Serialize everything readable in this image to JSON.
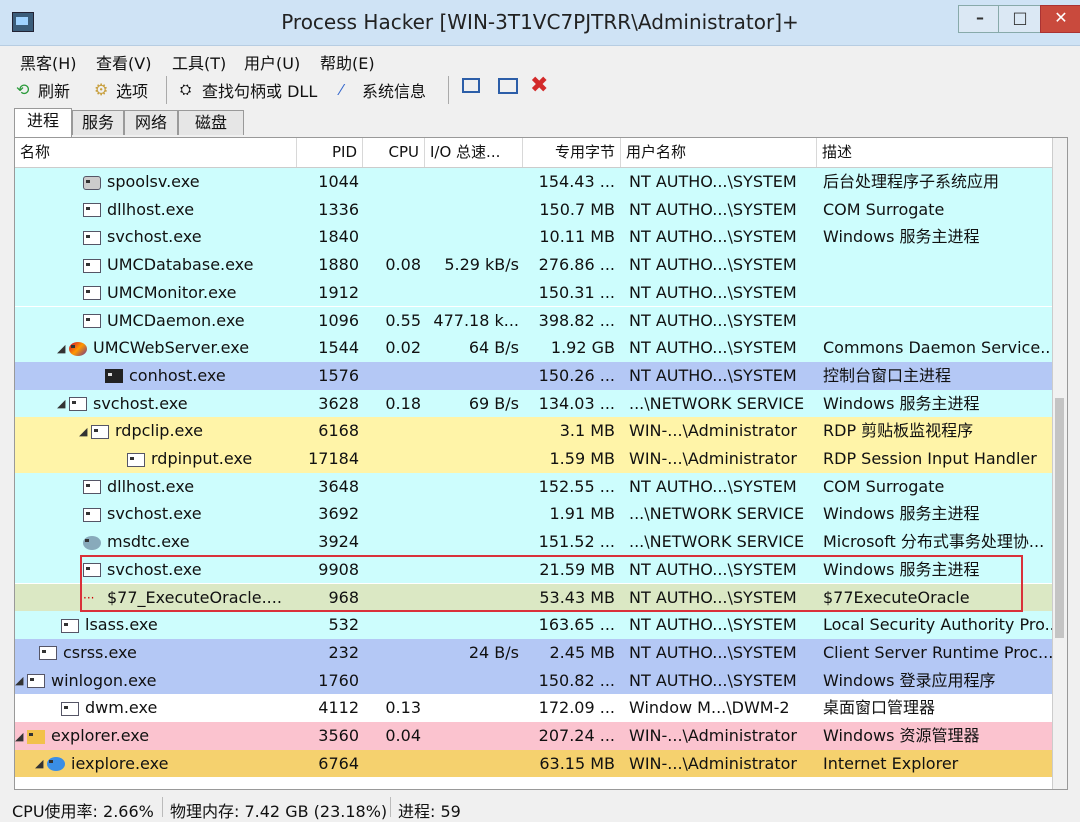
{
  "window": {
    "title": "Process Hacker [WIN-3T1VC7PJTRR\\Administrator]+"
  },
  "menu": [
    "黑客(H)",
    "查看(V)",
    "工具(T)",
    "用户(U)",
    "帮助(E)"
  ],
  "toolbar": {
    "refresh": "刷新",
    "options": "选项",
    "find": "查找句柄或 DLL",
    "sysinfo": "系统信息"
  },
  "tabs": [
    "进程",
    "服务",
    "网络",
    "磁盘"
  ],
  "columns": {
    "name": "名称",
    "pid": "PID",
    "cpu": "CPU",
    "io": "I/O 总速...",
    "mem": "专用字节",
    "user": "用户名称",
    "desc": "描述"
  },
  "colors": {
    "service": "#cdfdfd",
    "own": "#fff4a8",
    "system": "#b4c8f5",
    "pink": "#fbc3cf",
    "selected": "#dbe8c4",
    "white": "#ffffff",
    "orange": "#f5d16e"
  },
  "processes": [
    {
      "name": "spoolsv.exe",
      "pid": "1044",
      "cpu": "",
      "io": "",
      "mem": "154.43 ...",
      "user": "NT AUTHO...\\SYSTEM",
      "desc": "后台处理程序子系统应用",
      "icon": "printer-icon"
    },
    {
      "name": "dllhost.exe",
      "pid": "1336",
      "cpu": "",
      "io": "",
      "mem": "150.7 MB",
      "user": "NT AUTHO...\\SYSTEM",
      "desc": "COM Surrogate",
      "icon": "window-icon"
    },
    {
      "name": "svchost.exe",
      "pid": "1840",
      "cpu": "",
      "io": "",
      "mem": "10.11 MB",
      "user": "NT AUTHO...\\SYSTEM",
      "desc": "Windows 服务主进程",
      "icon": "window-icon"
    },
    {
      "name": "UMCDatabase.exe",
      "pid": "1880",
      "cpu": "0.08",
      "io": "5.29 kB/s",
      "mem": "276.86 ...",
      "user": "NT AUTHO...\\SYSTEM",
      "desc": "",
      "icon": "window-icon"
    },
    {
      "name": "UMCMonitor.exe",
      "pid": "1912",
      "cpu": "",
      "io": "",
      "mem": "150.31 ...",
      "user": "NT AUTHO...\\SYSTEM",
      "desc": "",
      "icon": "window-icon"
    },
    {
      "name": "UMCDaemon.exe",
      "pid": "1096",
      "cpu": "0.55",
      "io": "477.18 k...",
      "mem": "398.82 ...",
      "user": "NT AUTHO...\\SYSTEM",
      "desc": "",
      "icon": "window-icon"
    },
    {
      "name": "UMCWebServer.exe",
      "pid": "1544",
      "cpu": "0.02",
      "io": "64 B/s",
      "mem": "1.92 GB",
      "user": "NT AUTHO...\\SYSTEM",
      "desc": "Commons Daemon Service...",
      "icon": "feather-icon"
    },
    {
      "name": "conhost.exe",
      "pid": "1576",
      "cpu": "",
      "io": "",
      "mem": "150.26 ...",
      "user": "NT AUTHO...\\SYSTEM",
      "desc": "控制台窗口主进程",
      "icon": "console-icon"
    },
    {
      "name": "svchost.exe",
      "pid": "3628",
      "cpu": "0.18",
      "io": "69 B/s",
      "mem": "134.03 ...",
      "user": "...\\NETWORK SERVICE",
      "desc": "Windows 服务主进程",
      "icon": "window-icon"
    },
    {
      "name": "rdpclip.exe",
      "pid": "6168",
      "cpu": "",
      "io": "",
      "mem": "3.1 MB",
      "user": "WIN-...\\Administrator",
      "desc": "RDP 剪贴板监视程序",
      "icon": "window-icon"
    },
    {
      "name": "rdpinput.exe",
      "pid": "17184",
      "cpu": "",
      "io": "",
      "mem": "1.59 MB",
      "user": "WIN-...\\Administrator",
      "desc": "RDP Session Input Handler",
      "icon": "window-icon"
    },
    {
      "name": "dllhost.exe",
      "pid": "3648",
      "cpu": "",
      "io": "",
      "mem": "152.55 ...",
      "user": "NT AUTHO...\\SYSTEM",
      "desc": "COM Surrogate",
      "icon": "window-icon"
    },
    {
      "name": "svchost.exe",
      "pid": "3692",
      "cpu": "",
      "io": "",
      "mem": "1.91 MB",
      "user": "...\\NETWORK SERVICE",
      "desc": "Windows 服务主进程",
      "icon": "window-icon"
    },
    {
      "name": "msdtc.exe",
      "pid": "3924",
      "cpu": "",
      "io": "",
      "mem": "151.52 ...",
      "user": "...\\NETWORK SERVICE",
      "desc": "Microsoft 分布式事务处理协...",
      "icon": "msdtc-icon"
    },
    {
      "name": "svchost.exe",
      "pid": "9908",
      "cpu": "",
      "io": "",
      "mem": "21.59 MB",
      "user": "NT AUTHO...\\SYSTEM",
      "desc": "Windows 服务主进程",
      "icon": "window-icon"
    },
    {
      "name": "$77_ExecuteOracle....",
      "pid": "968",
      "cpu": "",
      "io": "",
      "mem": "53.43 MB",
      "user": "NT AUTHO...\\SYSTEM",
      "desc": "$77ExecuteOracle",
      "icon": "dots-icon"
    },
    {
      "name": "lsass.exe",
      "pid": "532",
      "cpu": "",
      "io": "",
      "mem": "163.65 ...",
      "user": "NT AUTHO...\\SYSTEM",
      "desc": "Local Security Authority Pro...",
      "icon": "window-icon"
    },
    {
      "name": "csrss.exe",
      "pid": "232",
      "cpu": "",
      "io": "24 B/s",
      "mem": "2.45 MB",
      "user": "NT AUTHO...\\SYSTEM",
      "desc": "Client Server Runtime Proc...",
      "icon": "window-icon"
    },
    {
      "name": "winlogon.exe",
      "pid": "1760",
      "cpu": "",
      "io": "",
      "mem": "150.82 ...",
      "user": "NT AUTHO...\\SYSTEM",
      "desc": "Windows 登录应用程序",
      "icon": "window-icon"
    },
    {
      "name": "dwm.exe",
      "pid": "4112",
      "cpu": "0.13",
      "io": "",
      "mem": "172.09 ...",
      "user": "Window M...\\DWM-2",
      "desc": "桌面窗口管理器",
      "icon": "window-icon"
    },
    {
      "name": "explorer.exe",
      "pid": "3560",
      "cpu": "0.04",
      "io": "",
      "mem": "207.24 ...",
      "user": "WIN-...\\Administrator",
      "desc": "Windows 资源管理器",
      "icon": "folder-icon"
    },
    {
      "name": "iexplore.exe",
      "pid": "6764",
      "cpu": "",
      "io": "",
      "mem": "63.15 MB",
      "user": "WIN-...\\Administrator",
      "desc": "Internet Explorer",
      "icon": "ie-icon"
    }
  ],
  "status": {
    "cpu": "CPU使用率: 2.66%",
    "mem": "物理内存: 7.42 GB (23.18%)",
    "procs": "进程: 59"
  }
}
